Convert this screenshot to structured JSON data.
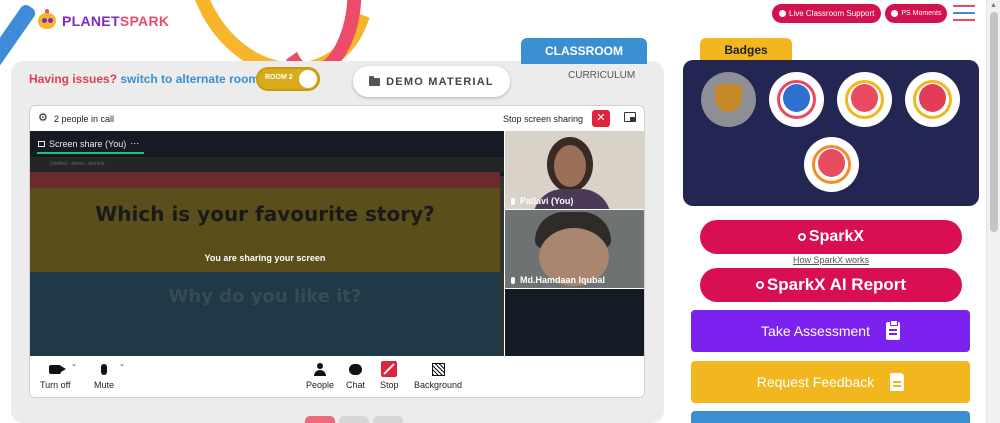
{
  "brand": {
    "logo_part1": "PLANET",
    "logo_part2": "SPARK"
  },
  "top_bar": {
    "live_support": "Live Classroom Support",
    "ps_moments": "PS Moments"
  },
  "tabs": {
    "classroom": "CLASSROOM",
    "curriculum": "CURRICULUM"
  },
  "issues": {
    "prefix": "Having issues?",
    "link": "switch to alternate room"
  },
  "room_toggle": {
    "label": "ROOM 2"
  },
  "demo_material": "DEMO MATERIAL",
  "call": {
    "people_count": "2 people in call",
    "stop_sharing": "Stop screen sharing",
    "share_tab": "Screen share (You)",
    "share_menu": "⋯",
    "inner_bar_text": "Untitled - demo - planets",
    "slide_question_1": "Which is your favourite story?",
    "sharing_message": "You are sharing your screen",
    "slide_question_2": "Why do you like it?",
    "participants": [
      {
        "name": "Pallavi (You)"
      },
      {
        "name": "Md.Hamdaan Iqubal"
      }
    ],
    "controls": {
      "turn_off": "Turn off",
      "mute": "Mute",
      "people": "People",
      "chat": "Chat",
      "stop": "Stop",
      "background": "Background"
    }
  },
  "badges": {
    "title": "Badges"
  },
  "sidebar": {
    "sparkx": "SparkX",
    "how_sparkx": "How SparkX works",
    "sparkx_report": "SparkX AI Report",
    "take_assessment": "Take Assessment",
    "request_feedback": "Request Feedback"
  },
  "colors": {
    "brand_red": "#d80f52",
    "classroom_blue": "#3a8fd0",
    "badges_yellow": "#f2b71e",
    "badges_panel": "#232552",
    "assessment_purple": "#7c22ee",
    "feedback_yellow": "#f2b71e"
  }
}
